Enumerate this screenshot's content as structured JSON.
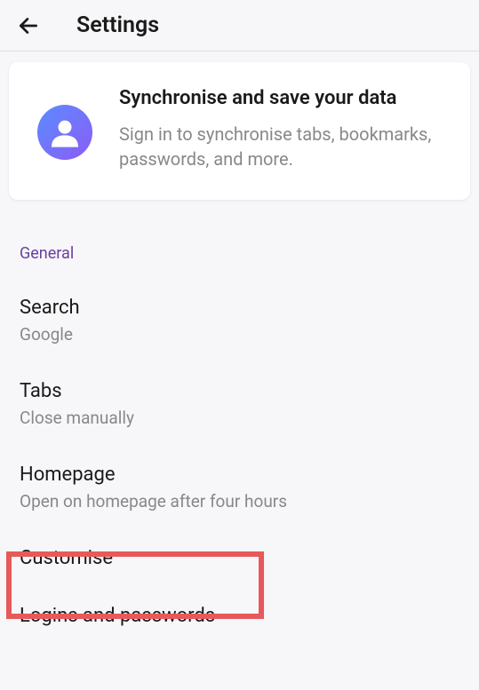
{
  "header": {
    "title": "Settings"
  },
  "sync": {
    "title": "Synchronise and save your data",
    "subtitle": "Sign in to synchronise tabs, bookmarks, passwords, and more."
  },
  "section_header": "General",
  "items": [
    {
      "title": "Search",
      "subtitle": "Google"
    },
    {
      "title": "Tabs",
      "subtitle": "Close manually"
    },
    {
      "title": "Homepage",
      "subtitle": "Open on homepage after four hours"
    },
    {
      "title": "Customise",
      "subtitle": ""
    },
    {
      "title": "Logins and passwords",
      "subtitle": ""
    }
  ]
}
